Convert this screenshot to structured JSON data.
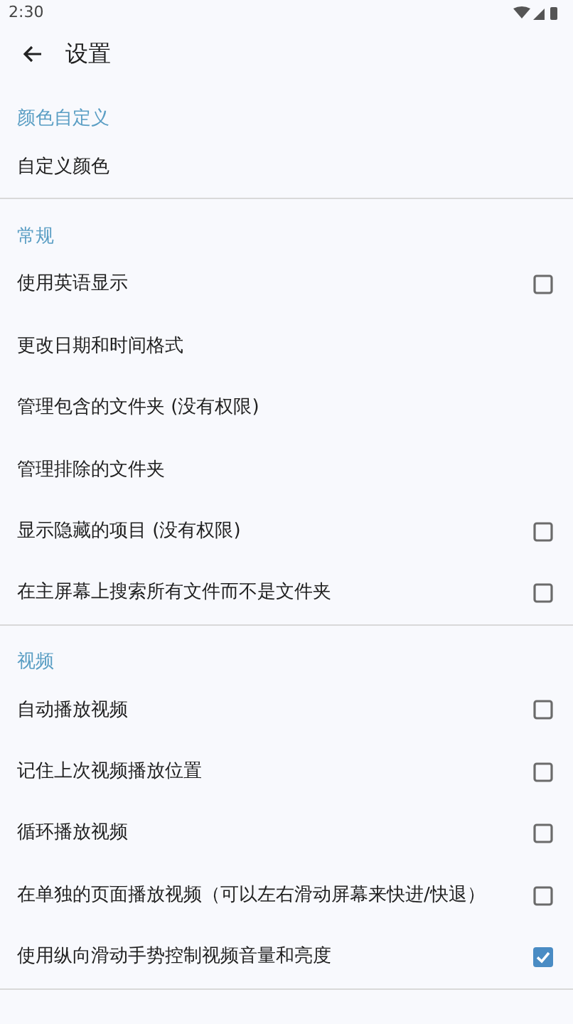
{
  "status_bar": {
    "time": "2:30"
  },
  "top_bar": {
    "title": "设置"
  },
  "sections": [
    {
      "header": "颜色自定义",
      "items": [
        {
          "kind": "plain",
          "label": "自定义颜色"
        }
      ]
    },
    {
      "header": "常规",
      "items": [
        {
          "kind": "checkbox",
          "label": "使用英语显示",
          "checked": false
        },
        {
          "kind": "plain",
          "label": "更改日期和时间格式"
        },
        {
          "kind": "plain",
          "label": "管理包含的文件夹 (没有权限)"
        },
        {
          "kind": "plain",
          "label": "管理排除的文件夹"
        },
        {
          "kind": "checkbox",
          "label": "显示隐藏的项目 (没有权限)",
          "checked": false
        },
        {
          "kind": "checkbox",
          "label": "在主屏幕上搜索所有文件而不是文件夹",
          "checked": false
        }
      ]
    },
    {
      "header": "视频",
      "items": [
        {
          "kind": "checkbox",
          "label": "自动播放视频",
          "checked": false
        },
        {
          "kind": "checkbox",
          "label": "记住上次视频播放位置",
          "checked": false
        },
        {
          "kind": "checkbox",
          "label": "循环播放视频",
          "checked": false
        },
        {
          "kind": "checkbox",
          "label": "在单独的页面播放视频（可以左右滑动屏幕来快进/快退）",
          "checked": false
        },
        {
          "kind": "checkbox",
          "label": "使用纵向滑动手势控制视频音量和亮度",
          "checked": true
        }
      ]
    }
  ]
}
